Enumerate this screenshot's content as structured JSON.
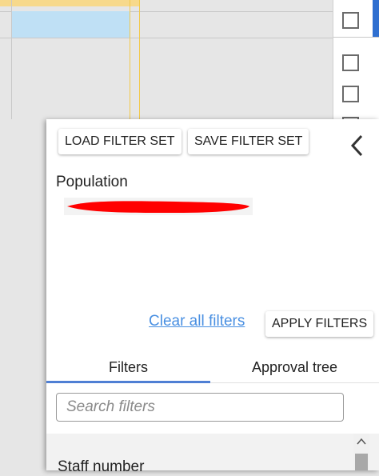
{
  "panel": {
    "load_filter_set": "LOAD FILTER SET",
    "save_filter_set": "SAVE FILTER SET",
    "population_label": "Population",
    "clear_all_filters": "Clear all filters",
    "apply_filters": "APPLY FILTERS",
    "tabs": [
      {
        "label": "Filters",
        "active": true
      },
      {
        "label": "Approval tree",
        "active": false
      }
    ],
    "search_placeholder": "Search filters",
    "first_filter": "Staff number"
  },
  "colors": {
    "accent": "#4f7fd4",
    "link": "#4a90e2",
    "redaction": "#ff0000",
    "selection": "#bfe0f5",
    "header_yellow": "#f7d98c"
  },
  "icons": {
    "collapse": "chevron-left-icon",
    "scroll_up": "chevron-up-icon"
  }
}
